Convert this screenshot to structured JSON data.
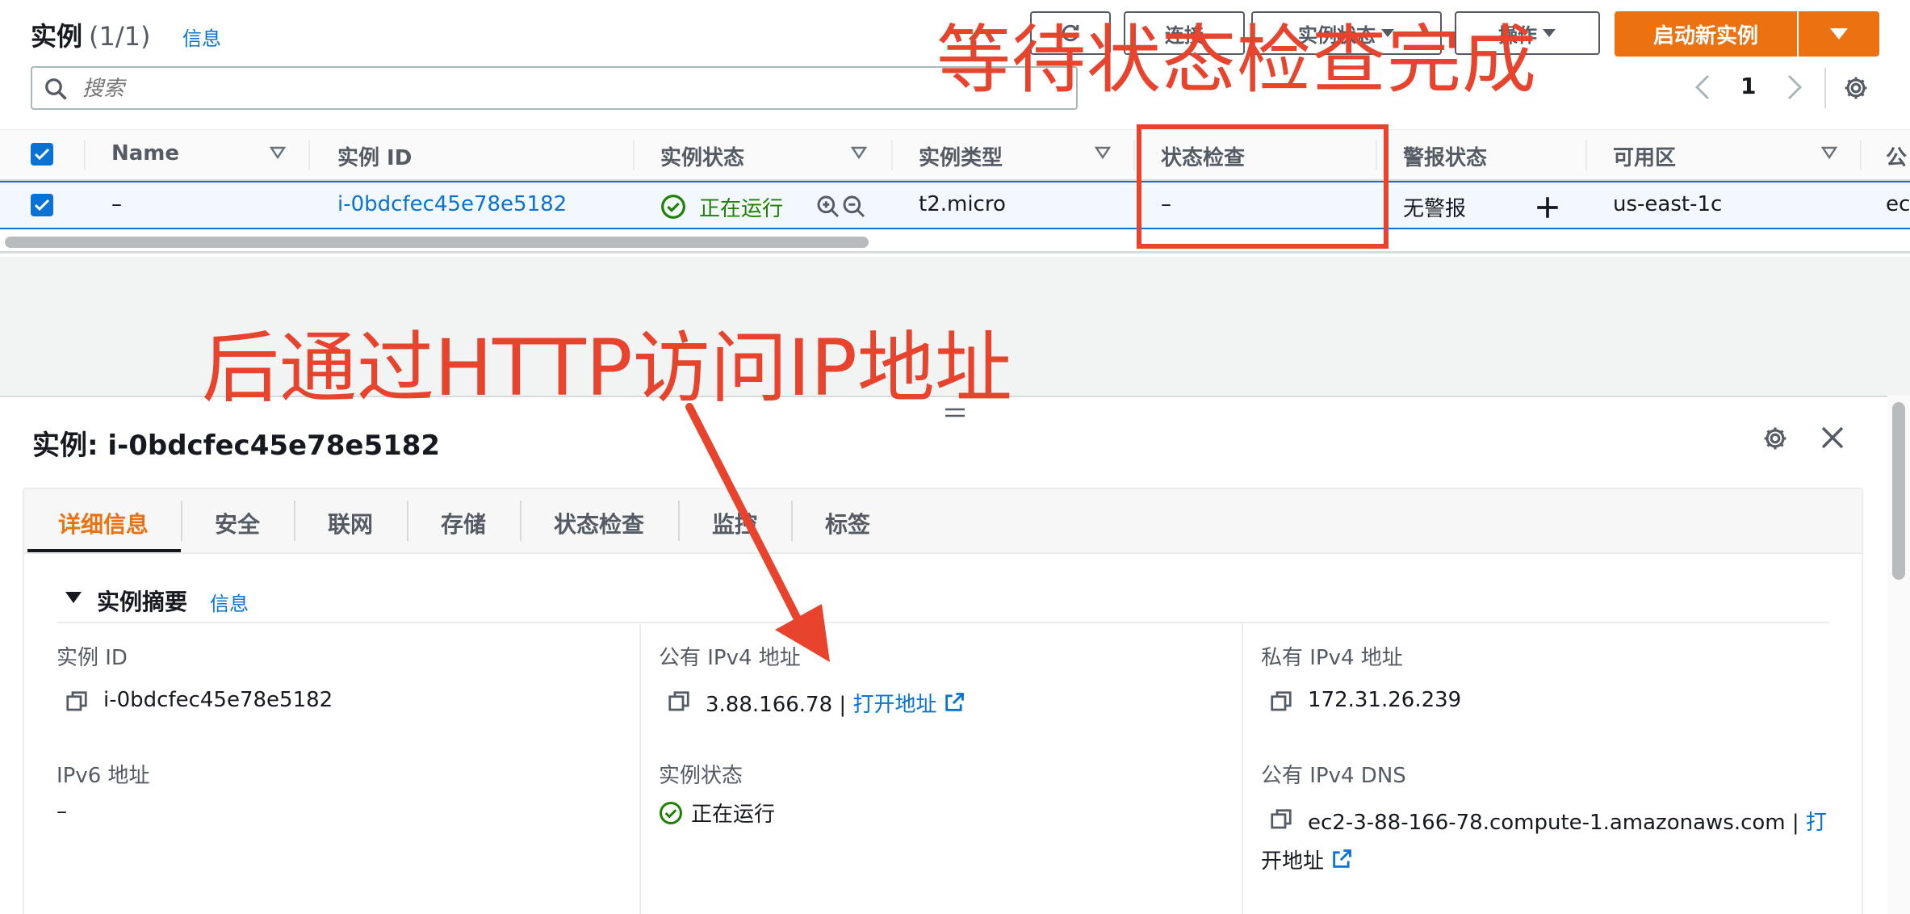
{
  "header": {
    "title": "实例",
    "count": "(1/1)",
    "info": "信息",
    "btn_connect": "连接",
    "btn_state": "实例状态",
    "btn_actions": "操作",
    "btn_launch": "启动新实例",
    "search_placeholder": "搜索",
    "page": "1"
  },
  "table": {
    "columns": [
      "Name",
      "实例 ID",
      "实例状态",
      "实例类型",
      "状态检查",
      "警报状态",
      "可用区",
      "公"
    ],
    "row": {
      "name": "–",
      "instance_id": "i-0bdcfec45e78e5182",
      "state": "正在运行",
      "type": "t2.micro",
      "status_check": "–",
      "alarm": "无警报",
      "az": "us-east-1c",
      "public": "ec"
    }
  },
  "detail": {
    "title": "实例: i-0bdcfec45e78e5182",
    "tabs": [
      "详细信息",
      "安全",
      "联网",
      "存储",
      "状态检查",
      "监控",
      "标签"
    ],
    "section_title": "实例摘要",
    "section_info": "信息",
    "fields": {
      "instance_id_label": "实例 ID",
      "instance_id_value": "i-0bdcfec45e78e5182",
      "public_ipv4_label": "公有 IPv4 地址",
      "public_ipv4_value": "3.88.166.78",
      "open_address": "打开地址",
      "private_ipv4_label": "私有 IPv4 地址",
      "private_ipv4_value": "172.31.26.239",
      "ipv6_label": "IPv6 地址",
      "ipv6_value": "–",
      "state_label": "实例状态",
      "state_value": "正在运行",
      "public_dns_label": "公有 IPv4 DNS",
      "public_dns_value": "ec2-3-88-166-78.compute-1.amazonaws.com",
      "open_address_dns_1": "打",
      "open_address_dns_2": "开地址",
      "separator": "|"
    }
  },
  "annotations": {
    "top": "等待状态检查完成",
    "middle": "后通过HTTP访问IP地址"
  },
  "colors": {
    "accent": "#ec7211",
    "link": "#0972d3",
    "success": "#1d8102",
    "annotation": "#e8432d"
  }
}
